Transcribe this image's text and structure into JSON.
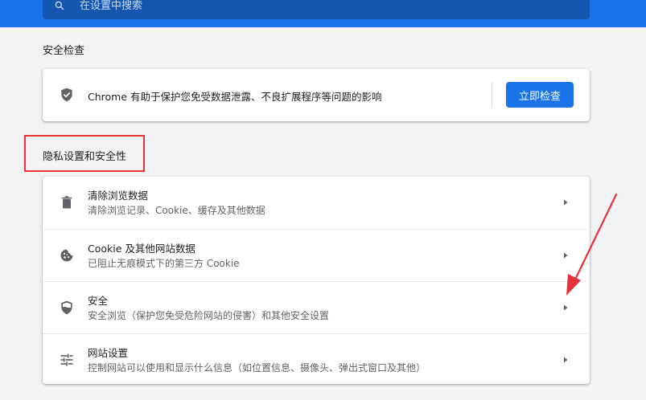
{
  "search": {
    "placeholder": "在设置中搜索"
  },
  "safety_check": {
    "section_title": "安全检查",
    "description": "Chrome 有助于保护您免受数据泄露、不良扩展程序等问题的影响",
    "button_label": "立即检查"
  },
  "privacy": {
    "section_title": "隐私设置和安全性",
    "items": [
      {
        "title": "清除浏览数据",
        "subtitle": "清除浏览记录、Cookie、缓存及其他数据",
        "icon": "trash-icon"
      },
      {
        "title": "Cookie 及其他网站数据",
        "subtitle": "已阻止无痕模式下的第三方 Cookie",
        "icon": "cookie-icon"
      },
      {
        "title": "安全",
        "subtitle": "安全浏览（保护您免受危险网站的侵害）和其他安全设置",
        "icon": "shield-icon"
      },
      {
        "title": "网站设置",
        "subtitle": "控制网站可以使用和显示什么信息（如位置信息、摄像头、弹出式窗口及其他）",
        "icon": "tune-icon"
      }
    ]
  },
  "colors": {
    "accent": "#1a73e8",
    "annotation_red": "#e8303a"
  }
}
